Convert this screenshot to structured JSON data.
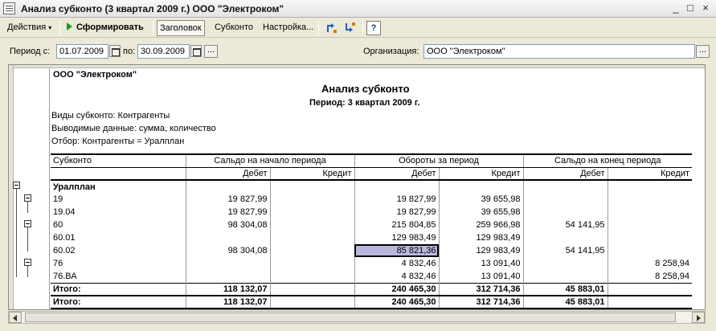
{
  "window": {
    "title": "Анализ субконто (3 квартал 2009 г.) ООО \"Электроком\""
  },
  "toolbar": {
    "actions_label": "Действия",
    "run_label": "Сформировать",
    "header_label": "Заголовок",
    "subkonto_label": "Субконто",
    "settings_label": "Настройка...",
    "help_label": "?"
  },
  "params": {
    "period_from_label": "Период с:",
    "period_from_value": "01.07.2009",
    "period_to_label": "по:",
    "period_to_value": "30.09.2009",
    "dots": "...",
    "org_label": "Организация:",
    "org_value": "ООО \"Электроком\""
  },
  "report": {
    "company": "ООО \"Электроком\"",
    "title": "Анализ субконто",
    "period": "Период: 3 квартал 2009 г.",
    "info": [
      "Виды субконто: Контрагенты",
      "Выводимые данные: сумма, количество",
      "Отбор: Контрагенты = Уралплан"
    ],
    "headers": {
      "subkonto": "Субконто",
      "saldo_start": "Сальдо на начало периода",
      "turnover": "Обороты за период",
      "saldo_end": "Сальдо на конец периода",
      "debit": "Дебет",
      "credit": "Кредит"
    },
    "group_name": "Уралплан",
    "rows": [
      {
        "name": "19",
        "sd": "19 827,99",
        "sc": "",
        "td": "19 827,99",
        "tc": "39 655,98",
        "ed": "",
        "ec": ""
      },
      {
        "name": "19.04",
        "sd": "19 827,99",
        "sc": "",
        "td": "19 827,99",
        "tc": "39 655,98",
        "ed": "",
        "ec": ""
      },
      {
        "name": "60",
        "sd": "98 304,08",
        "sc": "",
        "td": "215 804,85",
        "tc": "259 966,98",
        "ed": "54 141,95",
        "ec": ""
      },
      {
        "name": "60.01",
        "sd": "",
        "sc": "",
        "td": "129 983,49",
        "tc": "129 983,49",
        "ed": "",
        "ec": ""
      },
      {
        "name": "60.02",
        "sd": "98 304,08",
        "sc": "",
        "td": "85 821,36",
        "tc": "129 983,49",
        "ed": "54 141,95",
        "ec": ""
      },
      {
        "name": "76",
        "sd": "",
        "sc": "",
        "td": "4 832,46",
        "tc": "13 091,40",
        "ed": "",
        "ec": "8 258,94"
      },
      {
        "name": "76.ВА",
        "sd": "",
        "sc": "",
        "td": "4 832,46",
        "tc": "13 091,40",
        "ed": "",
        "ec": "8 258,94"
      }
    ],
    "subtotal": {
      "name": "Итого:",
      "sd": "118 132,07",
      "sc": "",
      "td": "240 465,30",
      "tc": "312 714,36",
      "ed": "45 883,01",
      "ec": ""
    },
    "total": {
      "name": "Итого:",
      "sd": "118 132,07",
      "sc": "",
      "td": "240 465,30",
      "tc": "312 714,36",
      "ed": "45 883,01",
      "ec": ""
    }
  }
}
